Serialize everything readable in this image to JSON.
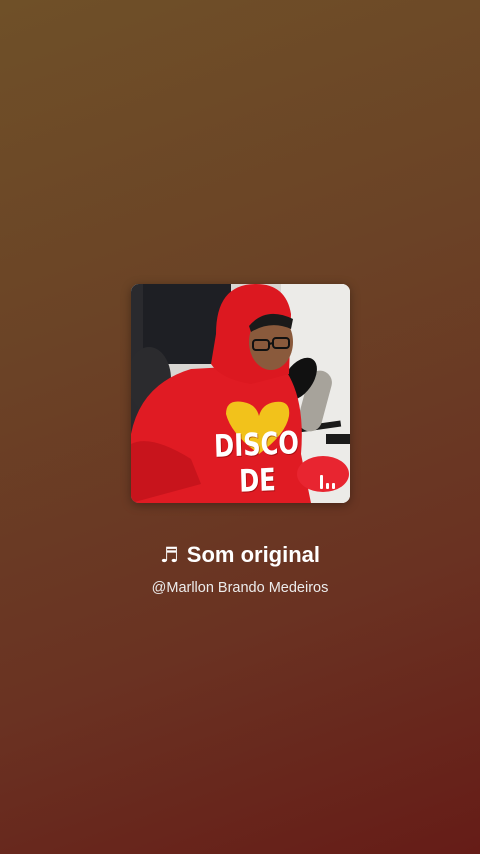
{
  "audio": {
    "cover_caption": "DISCO\nDE VINIL",
    "note_icon": "♬",
    "title": "Som original",
    "author": "@Marllon Brando Medeiros"
  },
  "icons": {
    "cover_badge": "audio-bars-icon",
    "title_icon": "music-note-icon"
  },
  "colors": {
    "background_top": "#6f5028",
    "background_bottom": "#661c17",
    "hoodie_red": "#e01b23",
    "text": "#ffffff"
  }
}
